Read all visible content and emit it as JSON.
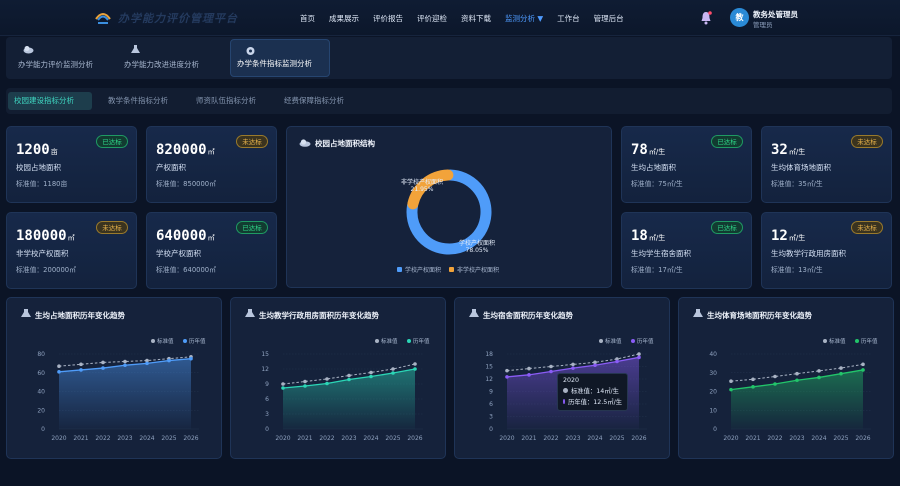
{
  "header": {
    "app_title": "办学能力评价管理平台",
    "nav": [
      "首页",
      "成果展示",
      "评价报告",
      "评价迎检",
      "资料下载",
      "监测分析 ▼",
      "工作台",
      "管理后台"
    ],
    "active_nav": 5,
    "user": {
      "avatar_text": "教",
      "name": "教务处管理员",
      "role": "管理员"
    }
  },
  "module_tabs": [
    "办学能力评价监测分析",
    "办学能力改进进度分析",
    "办学条件指标监测分析"
  ],
  "active_module": 2,
  "sub_tabs": [
    "校园建设指标分析",
    "教学条件指标分析",
    "师资队伍指标分析",
    "经费保障指标分析"
  ],
  "active_sub": 0,
  "kpis": [
    {
      "value": "1200",
      "unit": "亩",
      "label": "校园占地面积",
      "standard": "标准值：1180亩",
      "status": "已达标",
      "ok": true
    },
    {
      "value": "820000",
      "unit": "㎡",
      "label": "产权面积",
      "standard": "标准值：850000㎡",
      "status": "未达标",
      "ok": false
    },
    {
      "value": "180000",
      "unit": "㎡",
      "label": "非学校产权面积",
      "standard": "标准值：200000㎡",
      "status": "未达标",
      "ok": false
    },
    {
      "value": "640000",
      "unit": "㎡",
      "label": "学校产权面积",
      "standard": "标准值：640000㎡",
      "status": "已达标",
      "ok": true
    },
    {
      "value": "78",
      "unit": "㎡/生",
      "label": "生均占地面积",
      "standard": "标准值：75㎡/生",
      "status": "已达标",
      "ok": true
    },
    {
      "value": "32",
      "unit": "㎡/生",
      "label": "生均体育场地面积",
      "standard": "标准值：35㎡/生",
      "status": "未达标",
      "ok": false
    },
    {
      "value": "18",
      "unit": "㎡/生",
      "label": "生均学生宿舍面积",
      "standard": "标准值：17㎡/生",
      "status": "已达标",
      "ok": true
    },
    {
      "value": "12",
      "unit": "㎡/生",
      "label": "生均教学行政用房面积",
      "standard": "标准值：13㎡/生",
      "status": "未达标",
      "ok": false
    }
  ],
  "donut": {
    "title": "校园占地面积结构",
    "slices": [
      {
        "name": "学校产权面积",
        "pct_label": "78.05%",
        "value": 78.05,
        "color": "#4f9cf9"
      },
      {
        "name": "非学校产权面积",
        "pct_label": "21.95%",
        "value": 21.95,
        "color": "#f2a33a"
      }
    ]
  },
  "tooltip": {
    "year": "2020",
    "standard": "标准值：14㎡/生",
    "history": "历年值：12.5㎡/生"
  },
  "chart_data": [
    {
      "type": "line",
      "title": "生均占地面积历年变化趋势",
      "x": [
        "2020",
        "2021",
        "2022",
        "2023",
        "2024",
        "2025",
        "2026"
      ],
      "yticks": [
        0,
        20,
        40,
        60,
        80
      ],
      "ylim": [
        0,
        80
      ],
      "series": [
        {
          "name": "标准值",
          "values": [
            67,
            69,
            71,
            72,
            73,
            75,
            77
          ],
          "color": "#a9b3c4",
          "dashed": true
        },
        {
          "name": "历年值",
          "values": [
            61,
            63,
            65,
            68,
            70,
            73,
            75
          ],
          "color": "#4f9cf9"
        }
      ],
      "legend": "top-right"
    },
    {
      "type": "line",
      "title": "生均教学行政用房面积历年变化趋势",
      "x": [
        "2020",
        "2021",
        "2022",
        "2023",
        "2024",
        "2025",
        "2026"
      ],
      "yticks": [
        0,
        3,
        6,
        9,
        12,
        15
      ],
      "ylim": [
        0,
        15
      ],
      "series": [
        {
          "name": "标准值",
          "values": [
            9,
            9.5,
            10,
            10.7,
            11.3,
            12,
            13
          ],
          "color": "#a9b3c4",
          "dashed": true
        },
        {
          "name": "历年值",
          "values": [
            8.2,
            8.6,
            9.1,
            9.9,
            10.5,
            11.2,
            12
          ],
          "color": "#2bd6b6"
        }
      ],
      "legend": "top-right"
    },
    {
      "type": "line",
      "title": "生均宿舍面积历年变化趋势",
      "x": [
        "2020",
        "2021",
        "2022",
        "2023",
        "2024",
        "2025",
        "2026"
      ],
      "yticks": [
        0,
        3,
        6,
        9,
        12,
        15,
        18
      ],
      "ylim": [
        0,
        18
      ],
      "series": [
        {
          "name": "标准值",
          "values": [
            14,
            14.5,
            15,
            15.5,
            16,
            16.8,
            18
          ],
          "color": "#a9b3c4",
          "dashed": true
        },
        {
          "name": "历年值",
          "values": [
            12.5,
            13,
            13.8,
            14.6,
            15.3,
            16.2,
            17.2
          ],
          "color": "#8a5cf6"
        }
      ],
      "legend": "top-right"
    },
    {
      "type": "line",
      "title": "生均体育场地面积历年变化趋势",
      "x": [
        "2020",
        "2021",
        "2022",
        "2023",
        "2024",
        "2025",
        "2026"
      ],
      "yticks": [
        0,
        10,
        20,
        30,
        40
      ],
      "ylim": [
        0,
        40
      ],
      "series": [
        {
          "name": "标准值",
          "values": [
            25.5,
            26.5,
            28,
            29.5,
            31,
            32.5,
            34.5
          ],
          "color": "#a9b3c4",
          "dashed": true
        },
        {
          "name": "历年值",
          "values": [
            21,
            22.5,
            24,
            26,
            27.5,
            29.5,
            31.5
          ],
          "color": "#22c56a"
        }
      ],
      "legend": "top-right"
    }
  ]
}
